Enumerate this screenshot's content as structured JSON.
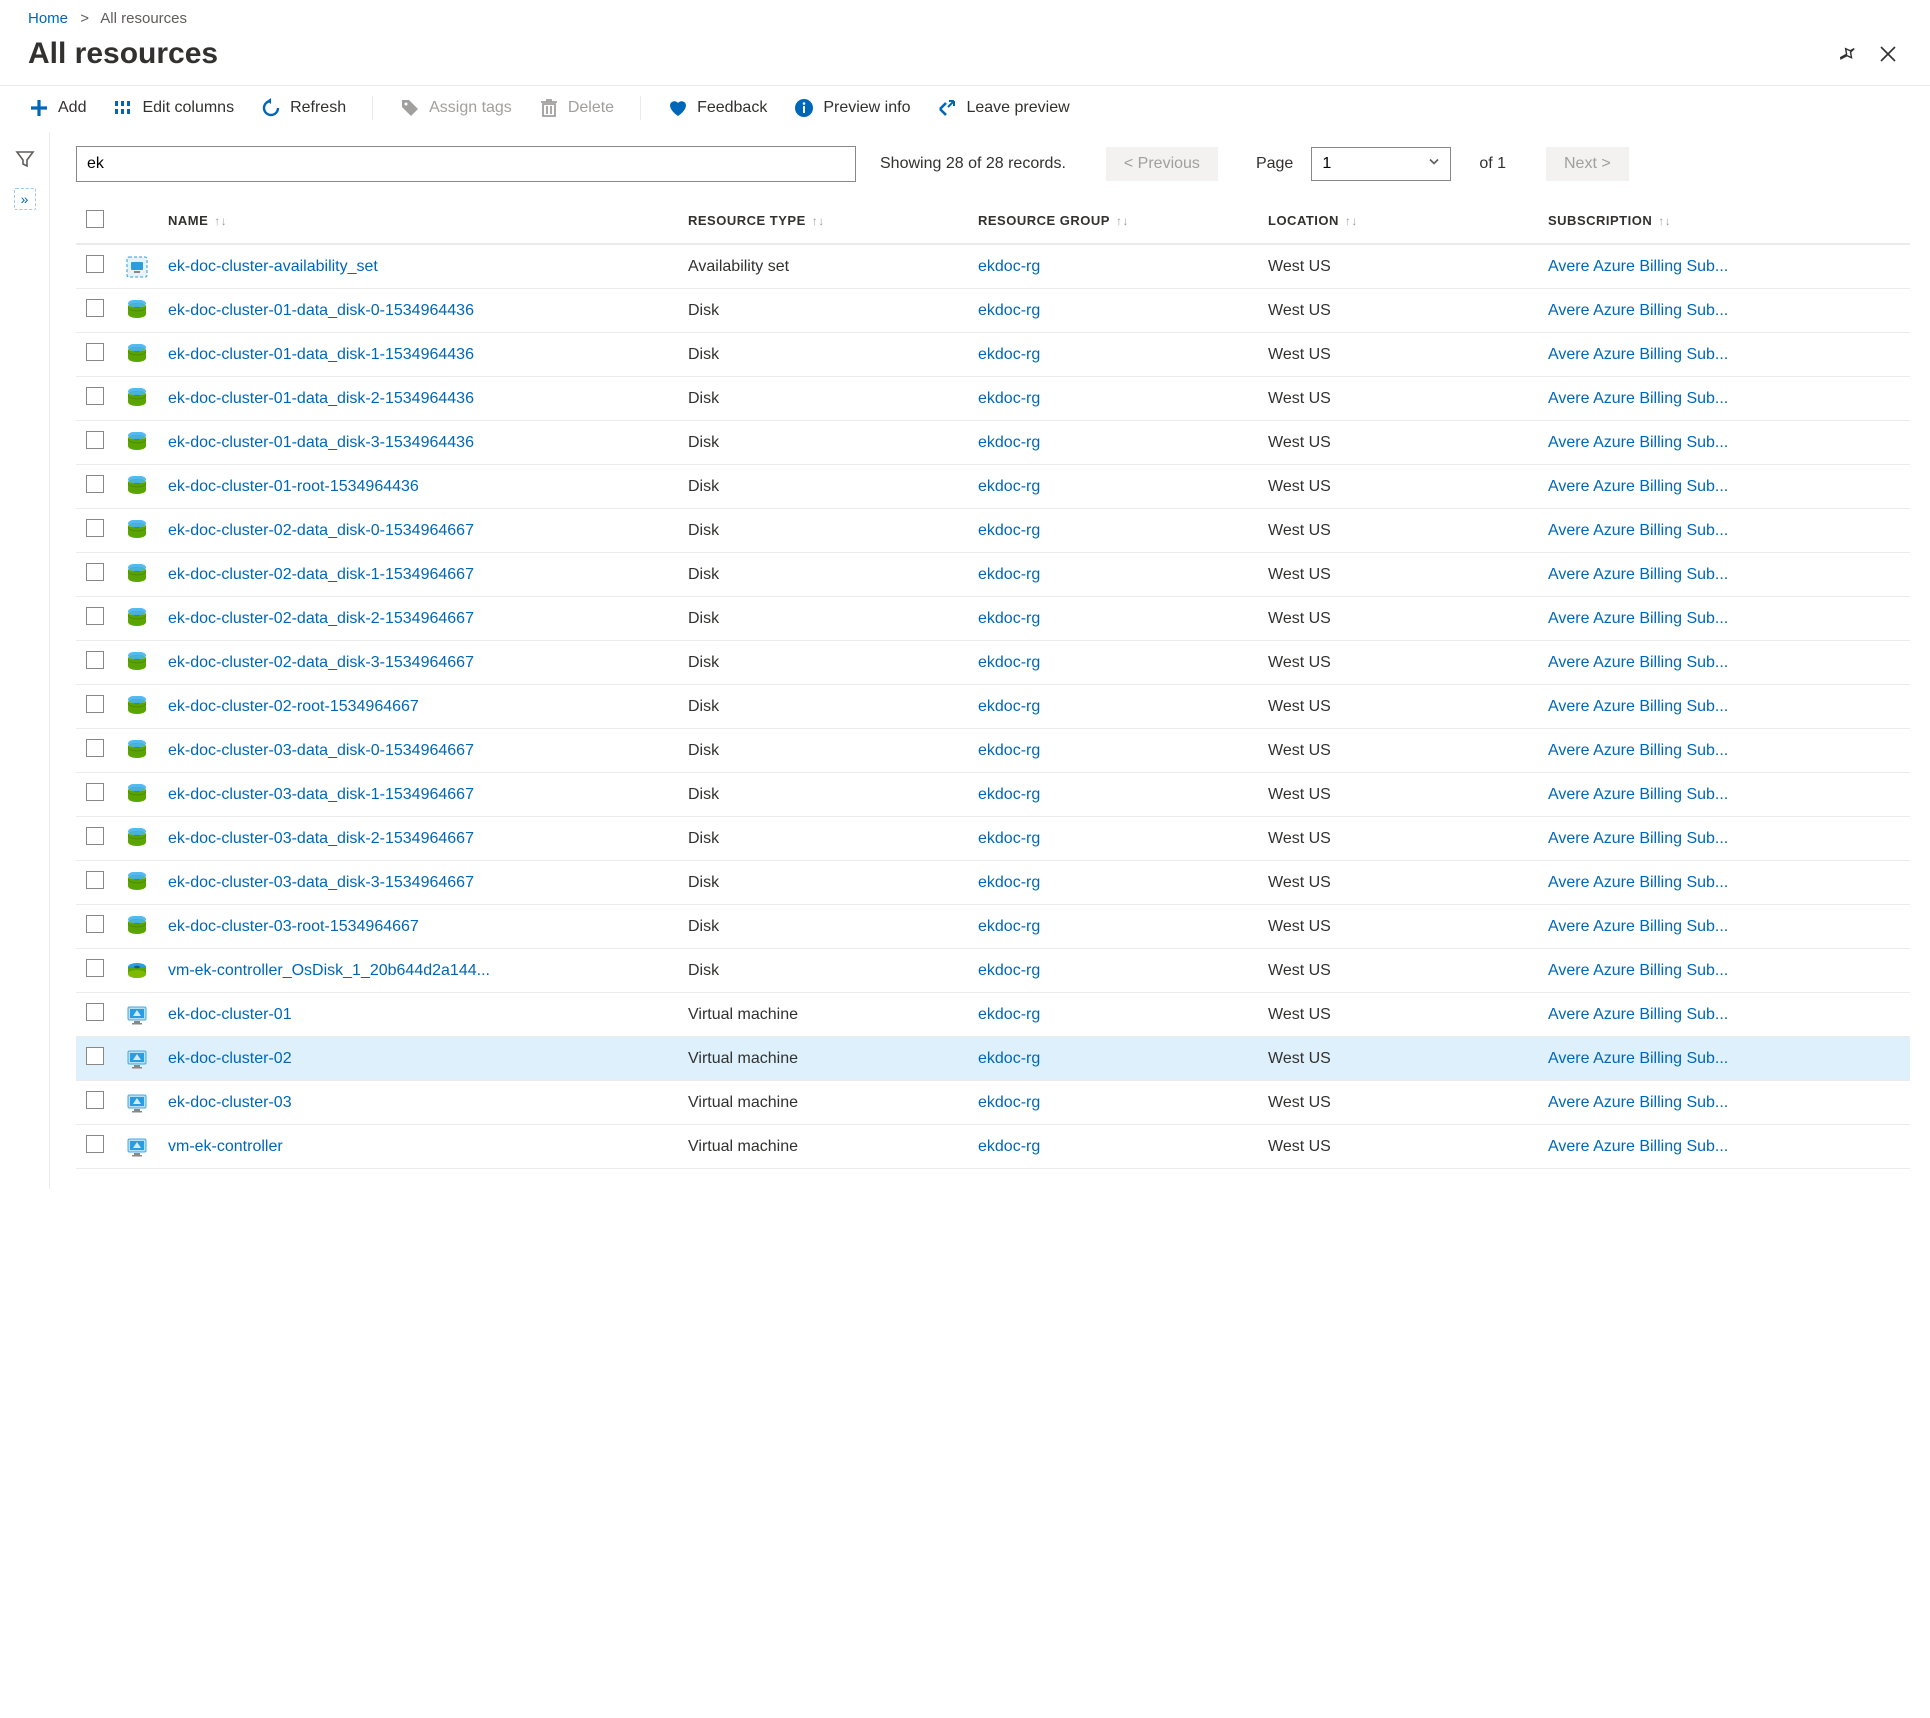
{
  "breadcrumb": {
    "home": "Home",
    "current": "All resources"
  },
  "title": "All resources",
  "toolbar": {
    "add": "Add",
    "edit_columns": "Edit columns",
    "refresh": "Refresh",
    "assign_tags": "Assign tags",
    "delete": "Delete",
    "feedback": "Feedback",
    "preview_info": "Preview info",
    "leave_preview": "Leave preview"
  },
  "search": {
    "value": "ek"
  },
  "pager": {
    "showing": "Showing 28 of 28 records.",
    "previous": "<  Previous",
    "next": "Next  >",
    "page_label": "Page",
    "page_value": "1",
    "of_label": "of 1"
  },
  "columns": {
    "name": "NAME",
    "type": "RESOURCE TYPE",
    "rg": "RESOURCE GROUP",
    "loc": "LOCATION",
    "sub": "SUBSCRIPTION"
  },
  "rows": [
    {
      "icon": "avset",
      "name": "ek-doc-cluster-availability_set",
      "type": "Availability set",
      "rg": "ekdoc-rg",
      "loc": "West US",
      "sub": "Avere Azure Billing Sub...",
      "highlight": false
    },
    {
      "icon": "disk",
      "name": "ek-doc-cluster-01-data_disk-0-1534964436",
      "type": "Disk",
      "rg": "ekdoc-rg",
      "loc": "West US",
      "sub": "Avere Azure Billing Sub...",
      "highlight": false
    },
    {
      "icon": "disk",
      "name": "ek-doc-cluster-01-data_disk-1-1534964436",
      "type": "Disk",
      "rg": "ekdoc-rg",
      "loc": "West US",
      "sub": "Avere Azure Billing Sub...",
      "highlight": false
    },
    {
      "icon": "disk",
      "name": "ek-doc-cluster-01-data_disk-2-1534964436",
      "type": "Disk",
      "rg": "ekdoc-rg",
      "loc": "West US",
      "sub": "Avere Azure Billing Sub...",
      "highlight": false
    },
    {
      "icon": "disk",
      "name": "ek-doc-cluster-01-data_disk-3-1534964436",
      "type": "Disk",
      "rg": "ekdoc-rg",
      "loc": "West US",
      "sub": "Avere Azure Billing Sub...",
      "highlight": false
    },
    {
      "icon": "disk",
      "name": "ek-doc-cluster-01-root-1534964436",
      "type": "Disk",
      "rg": "ekdoc-rg",
      "loc": "West US",
      "sub": "Avere Azure Billing Sub...",
      "highlight": false
    },
    {
      "icon": "disk",
      "name": "ek-doc-cluster-02-data_disk-0-1534964667",
      "type": "Disk",
      "rg": "ekdoc-rg",
      "loc": "West US",
      "sub": "Avere Azure Billing Sub...",
      "highlight": false
    },
    {
      "icon": "disk",
      "name": "ek-doc-cluster-02-data_disk-1-1534964667",
      "type": "Disk",
      "rg": "ekdoc-rg",
      "loc": "West US",
      "sub": "Avere Azure Billing Sub...",
      "highlight": false
    },
    {
      "icon": "disk",
      "name": "ek-doc-cluster-02-data_disk-2-1534964667",
      "type": "Disk",
      "rg": "ekdoc-rg",
      "loc": "West US",
      "sub": "Avere Azure Billing Sub...",
      "highlight": false
    },
    {
      "icon": "disk",
      "name": "ek-doc-cluster-02-data_disk-3-1534964667",
      "type": "Disk",
      "rg": "ekdoc-rg",
      "loc": "West US",
      "sub": "Avere Azure Billing Sub...",
      "highlight": false
    },
    {
      "icon": "disk",
      "name": "ek-doc-cluster-02-root-1534964667",
      "type": "Disk",
      "rg": "ekdoc-rg",
      "loc": "West US",
      "sub": "Avere Azure Billing Sub...",
      "highlight": false
    },
    {
      "icon": "disk",
      "name": "ek-doc-cluster-03-data_disk-0-1534964667",
      "type": "Disk",
      "rg": "ekdoc-rg",
      "loc": "West US",
      "sub": "Avere Azure Billing Sub...",
      "highlight": false
    },
    {
      "icon": "disk",
      "name": "ek-doc-cluster-03-data_disk-1-1534964667",
      "type": "Disk",
      "rg": "ekdoc-rg",
      "loc": "West US",
      "sub": "Avere Azure Billing Sub...",
      "highlight": false
    },
    {
      "icon": "disk",
      "name": "ek-doc-cluster-03-data_disk-2-1534964667",
      "type": "Disk",
      "rg": "ekdoc-rg",
      "loc": "West US",
      "sub": "Avere Azure Billing Sub...",
      "highlight": false
    },
    {
      "icon": "disk",
      "name": "ek-doc-cluster-03-data_disk-3-1534964667",
      "type": "Disk",
      "rg": "ekdoc-rg",
      "loc": "West US",
      "sub": "Avere Azure Billing Sub...",
      "highlight": false
    },
    {
      "icon": "disk",
      "name": "ek-doc-cluster-03-root-1534964667",
      "type": "Disk",
      "rg": "ekdoc-rg",
      "loc": "West US",
      "sub": "Avere Azure Billing Sub...",
      "highlight": false
    },
    {
      "icon": "diskblue",
      "name": "vm-ek-controller_OsDisk_1_20b644d2a144...",
      "type": "Disk",
      "rg": "ekdoc-rg",
      "loc": "West US",
      "sub": "Avere Azure Billing Sub...",
      "highlight": false
    },
    {
      "icon": "vm",
      "name": "ek-doc-cluster-01",
      "type": "Virtual machine",
      "rg": "ekdoc-rg",
      "loc": "West US",
      "sub": "Avere Azure Billing Sub...",
      "highlight": false
    },
    {
      "icon": "vm",
      "name": "ek-doc-cluster-02",
      "type": "Virtual machine",
      "rg": "ekdoc-rg",
      "loc": "West US",
      "sub": "Avere Azure Billing Sub...",
      "highlight": true
    },
    {
      "icon": "vm",
      "name": "ek-doc-cluster-03",
      "type": "Virtual machine",
      "rg": "ekdoc-rg",
      "loc": "West US",
      "sub": "Avere Azure Billing Sub...",
      "highlight": false
    },
    {
      "icon": "vm",
      "name": "vm-ek-controller",
      "type": "Virtual machine",
      "rg": "ekdoc-rg",
      "loc": "West US",
      "sub": "Avere Azure Billing Sub...",
      "highlight": false
    }
  ]
}
